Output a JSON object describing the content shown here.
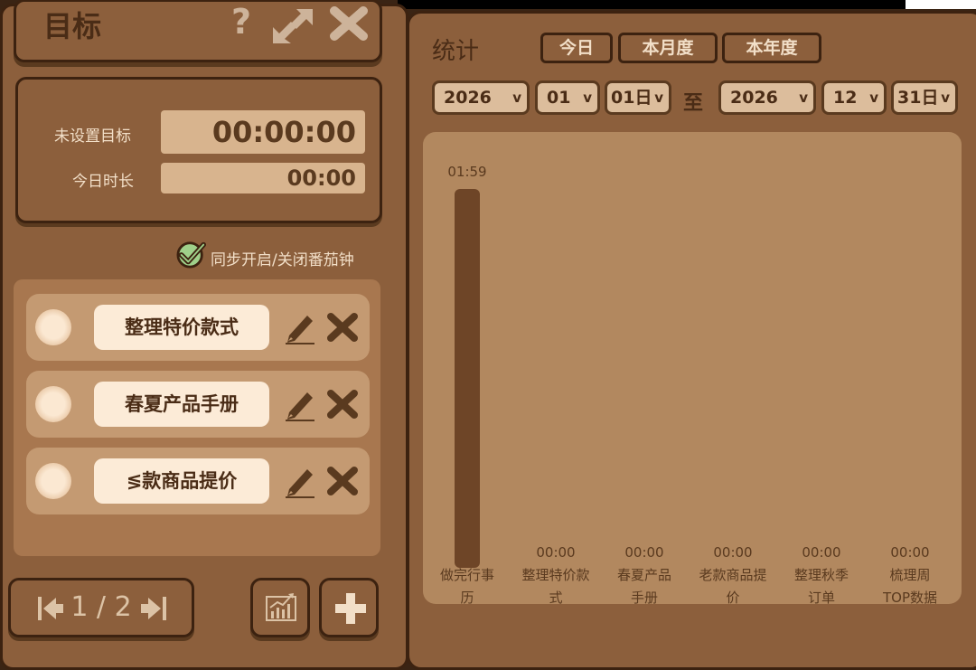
{
  "left_panel": {
    "title": "目标",
    "icons": {
      "help": "question-icon",
      "resize": "expand-arrows-icon",
      "close": "close-x-icon"
    },
    "goal": {
      "goal_label": "未设置目标",
      "goal_time": "00:00:00",
      "today_label": "今日时长",
      "today_time": "00:00"
    },
    "sync_checkbox": {
      "label": "同步开启/关闭番茄钟",
      "checked": true
    },
    "tasks": [
      {
        "name": "整理特价款式"
      },
      {
        "name": "春夏产品手册"
      },
      {
        "name": "≶款商品提价"
      }
    ],
    "pager": {
      "text": "1 / 2"
    }
  },
  "right_panel": {
    "title": "统计",
    "tabs": [
      "今日",
      "本月度",
      "本年度"
    ],
    "range": {
      "from": {
        "year": "2026",
        "month": "01",
        "day": "01日"
      },
      "separator": "至",
      "to": {
        "year": "2026",
        "month": "12",
        "day": "31日"
      },
      "chevron": "v"
    }
  },
  "chart_data": {
    "type": "bar",
    "categories": [
      [
        "做完行事",
        "历"
      ],
      [
        "整理特价款",
        "式"
      ],
      [
        "春夏产品",
        "手册"
      ],
      [
        "老款商品提",
        "价"
      ],
      [
        "整理秋季",
        "订单"
      ],
      [
        "梳理周",
        "TOP数据"
      ]
    ],
    "values": [
      119,
      0,
      0,
      0,
      0,
      0
    ],
    "value_labels": [
      "01:59",
      "00:00",
      "00:00",
      "00:00",
      "00:00",
      "00:00"
    ],
    "ylim": [
      0,
      125
    ],
    "colors": {
      "bar": "#6e4527",
      "background": "#b2885f"
    }
  }
}
